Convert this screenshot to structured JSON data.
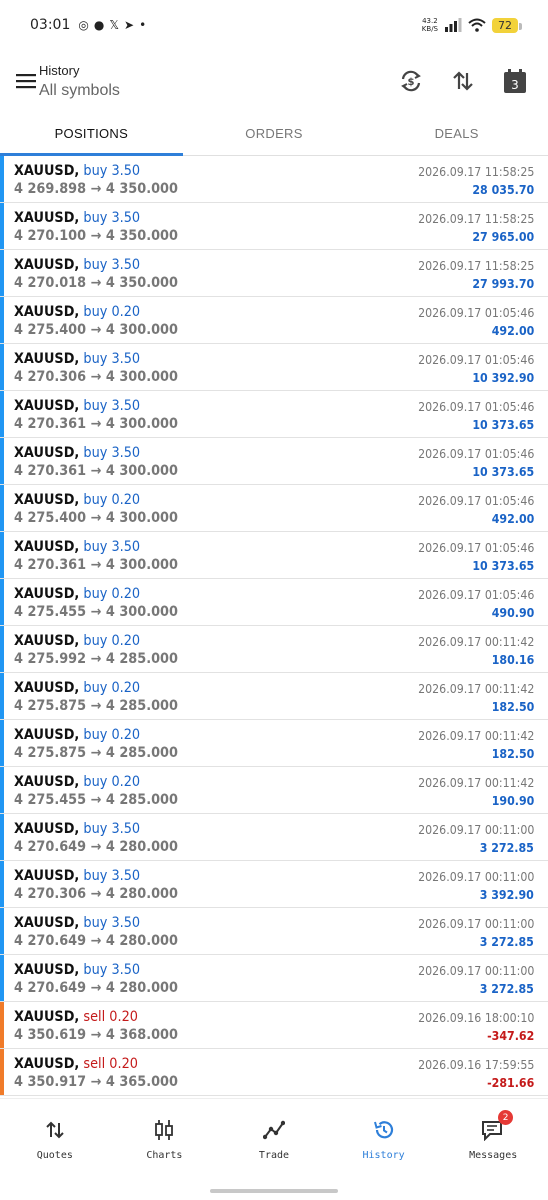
{
  "status_bar": {
    "time": "03:01",
    "net_speed_top": "43.2",
    "net_speed_bottom": "KB/S",
    "battery": "72"
  },
  "header": {
    "title": "History",
    "subtitle": "All symbols",
    "calendar_day": "3"
  },
  "tabs": [
    {
      "label": "POSITIONS"
    },
    {
      "label": "ORDERS"
    },
    {
      "label": "DEALS"
    }
  ],
  "positions": [
    {
      "symbol": "XAUUSD,",
      "direction": "buy 3.50",
      "prices": "4 269.898 → 4 350.000",
      "time": "2026.09.17 11:58:25",
      "profit": "28 035.70",
      "side": "buy"
    },
    {
      "symbol": "XAUUSD,",
      "direction": "buy 3.50",
      "prices": "4 270.100 → 4 350.000",
      "time": "2026.09.17 11:58:25",
      "profit": "27 965.00",
      "side": "buy"
    },
    {
      "symbol": "XAUUSD,",
      "direction": "buy 3.50",
      "prices": "4 270.018 → 4 350.000",
      "time": "2026.09.17 11:58:25",
      "profit": "27 993.70",
      "side": "buy"
    },
    {
      "symbol": "XAUUSD,",
      "direction": "buy 0.20",
      "prices": "4 275.400 → 4 300.000",
      "time": "2026.09.17 01:05:46",
      "profit": "492.00",
      "side": "buy"
    },
    {
      "symbol": "XAUUSD,",
      "direction": "buy 3.50",
      "prices": "4 270.306 → 4 300.000",
      "time": "2026.09.17 01:05:46",
      "profit": "10 392.90",
      "side": "buy"
    },
    {
      "symbol": "XAUUSD,",
      "direction": "buy 3.50",
      "prices": "4 270.361 → 4 300.000",
      "time": "2026.09.17 01:05:46",
      "profit": "10 373.65",
      "side": "buy"
    },
    {
      "symbol": "XAUUSD,",
      "direction": "buy 3.50",
      "prices": "4 270.361 → 4 300.000",
      "time": "2026.09.17 01:05:46",
      "profit": "10 373.65",
      "side": "buy"
    },
    {
      "symbol": "XAUUSD,",
      "direction": "buy 0.20",
      "prices": "4 275.400 → 4 300.000",
      "time": "2026.09.17 01:05:46",
      "profit": "492.00",
      "side": "buy"
    },
    {
      "symbol": "XAUUSD,",
      "direction": "buy 3.50",
      "prices": "4 270.361 → 4 300.000",
      "time": "2026.09.17 01:05:46",
      "profit": "10 373.65",
      "side": "buy"
    },
    {
      "symbol": "XAUUSD,",
      "direction": "buy 0.20",
      "prices": "4 275.455 → 4 300.000",
      "time": "2026.09.17 01:05:46",
      "profit": "490.90",
      "side": "buy"
    },
    {
      "symbol": "XAUUSD,",
      "direction": "buy 0.20",
      "prices": "4 275.992 → 4 285.000",
      "time": "2026.09.17 00:11:42",
      "profit": "180.16",
      "side": "buy"
    },
    {
      "symbol": "XAUUSD,",
      "direction": "buy 0.20",
      "prices": "4 275.875 → 4 285.000",
      "time": "2026.09.17 00:11:42",
      "profit": "182.50",
      "side": "buy"
    },
    {
      "symbol": "XAUUSD,",
      "direction": "buy 0.20",
      "prices": "4 275.875 → 4 285.000",
      "time": "2026.09.17 00:11:42",
      "profit": "182.50",
      "side": "buy"
    },
    {
      "symbol": "XAUUSD,",
      "direction": "buy 0.20",
      "prices": "4 275.455 → 4 285.000",
      "time": "2026.09.17 00:11:42",
      "profit": "190.90",
      "side": "buy"
    },
    {
      "symbol": "XAUUSD,",
      "direction": "buy 3.50",
      "prices": "4 270.649 → 4 280.000",
      "time": "2026.09.17 00:11:00",
      "profit": "3 272.85",
      "side": "buy"
    },
    {
      "symbol": "XAUUSD,",
      "direction": "buy 3.50",
      "prices": "4 270.306 → 4 280.000",
      "time": "2026.09.17 00:11:00",
      "profit": "3 392.90",
      "side": "buy"
    },
    {
      "symbol": "XAUUSD,",
      "direction": "buy 3.50",
      "prices": "4 270.649 → 4 280.000",
      "time": "2026.09.17 00:11:00",
      "profit": "3 272.85",
      "side": "buy"
    },
    {
      "symbol": "XAUUSD,",
      "direction": "buy 3.50",
      "prices": "4 270.649 → 4 280.000",
      "time": "2026.09.17 00:11:00",
      "profit": "3 272.85",
      "side": "buy"
    },
    {
      "symbol": "XAUUSD,",
      "direction": "sell 0.20",
      "prices": "4 350.619 → 4 368.000",
      "time": "2026.09.16 18:00:10",
      "profit": "-347.62",
      "side": "sell"
    },
    {
      "symbol": "XAUUSD,",
      "direction": "sell 0.20",
      "prices": "4 350.917 → 4 365.000",
      "time": "2026.09.16 17:59:55",
      "profit": "-281.66",
      "side": "sell"
    }
  ],
  "bottom_nav": [
    {
      "label": "Quotes",
      "icon": "quotes-icon"
    },
    {
      "label": "Charts",
      "icon": "charts-icon"
    },
    {
      "label": "Trade",
      "icon": "trade-icon"
    },
    {
      "label": "History",
      "icon": "history-icon"
    },
    {
      "label": "Messages",
      "icon": "messages-icon",
      "badge": "2"
    }
  ],
  "colors": {
    "accent": "#2e7fd9",
    "buy": "#1a63c6",
    "sell": "#c41a1a",
    "buy_bar": "#2196f3",
    "sell_bar": "#f07b2a"
  }
}
